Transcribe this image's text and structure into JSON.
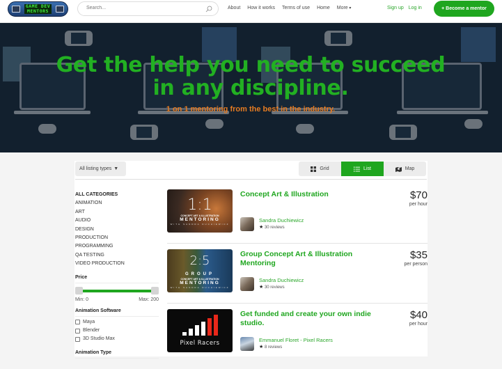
{
  "header": {
    "logo_line1": "GAME DEV",
    "logo_line2": "MENTORS",
    "search_placeholder": "Search...",
    "nav": [
      "About",
      "How it works",
      "Terms of use",
      "Home",
      "More"
    ],
    "signup": "Sign up",
    "login": "Log in",
    "become_mentor": "+ Become a mentor"
  },
  "hero": {
    "title": "Get the help you need to succeed in any discipline.",
    "subtitle": "1 on 1 mentoring from the best in the industry."
  },
  "toolbar": {
    "listing_types": "All listing types",
    "views": [
      {
        "label": "Grid",
        "icon": "grid-icon",
        "active": false
      },
      {
        "label": "List",
        "icon": "list-icon",
        "active": true
      },
      {
        "label": "Map",
        "icon": "map-icon",
        "active": false
      }
    ]
  },
  "sidebar": {
    "categories": [
      "ALL CATEGORIES",
      "ANIMATION",
      "ART",
      "AUDIO",
      "DESIGN",
      "PRODUCTION",
      "PROGRAMMING",
      "QA TESTING",
      "VIDEO PRODUCTION"
    ],
    "price": {
      "heading": "Price",
      "min_label": "Min: 0",
      "max_label": "Max: 200",
      "min": 0,
      "max": 200
    },
    "animation_software": {
      "heading": "Animation Software",
      "options": [
        "Maya",
        "Blender",
        "3D Studio Max"
      ]
    },
    "animation_type": {
      "heading": "Animation Type"
    }
  },
  "listings": [
    {
      "title": "Concept Art & Illustration",
      "price": "$70",
      "unit": "per hour",
      "author": "Sandra Duchiewicz",
      "reviews": "30 reviews",
      "thumb": {
        "big": "1:1",
        "cap1": "CONCEPT ART & ILLUSTRATION",
        "cap2": "MENTORING",
        "cap3": "WITH SANDRA DUCHIEWICZ"
      }
    },
    {
      "title": "Group Concept Art & Illustration Mentoring",
      "price": "$35",
      "unit": "per person",
      "author": "Sandra Duchiewicz",
      "reviews": "30 reviews",
      "thumb": {
        "big": "2:5",
        "grp": "GROUP",
        "cap1": "CONCEPT ART & ILLUSTRATION",
        "cap2": "MENTORING",
        "cap3": "WITH SANDRA DUCHIEWICZ"
      }
    },
    {
      "title": "Get funded and create your own indie studio.",
      "price": "$40",
      "unit": "per hour",
      "author": "Emmanuel Floret - Pixel Racers",
      "reviews": "8 reviews",
      "thumb": {
        "brand": "Pixel Racers"
      }
    }
  ],
  "colors": {
    "brand_green": "#1fa61f",
    "accent_orange": "#e57b22",
    "hero_bg": "#12202e"
  }
}
